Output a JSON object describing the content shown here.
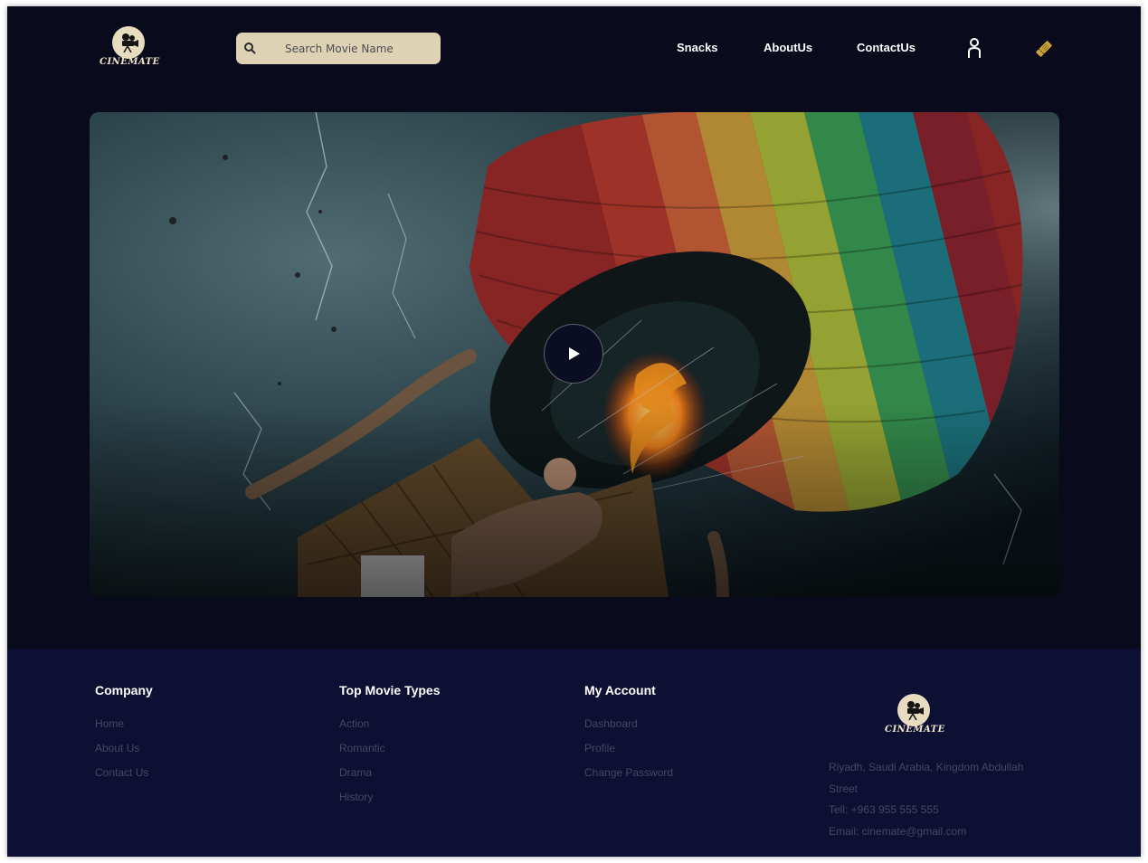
{
  "header": {
    "logo_text": "CINEMATE",
    "search_placeholder": "Search Movie Name",
    "nav": [
      "Snacks",
      "AboutUs",
      "ContactUs"
    ],
    "icons": {
      "search": "search-icon",
      "user": "user-icon",
      "ticket": "ticket-icon"
    }
  },
  "hero": {
    "play_icon": "play-icon"
  },
  "footer": {
    "columns": [
      {
        "title": "Company",
        "links": [
          "Home",
          "About Us",
          "Contact Us"
        ]
      },
      {
        "title": "Top Movie Types",
        "links": [
          "Action",
          "Romantic",
          "Drama",
          "History"
        ]
      },
      {
        "title": "My Account",
        "links": [
          "Dashboard",
          "Profile",
          "Change Password"
        ]
      }
    ],
    "logo_text": "CINEMATE",
    "address_line1": "Riyadh, Saudi Arabia, Kingdom Abdullah",
    "address_line2": "Street",
    "phone": "Tell: +963 955 555 555",
    "email": "Email: cinemate@gmail.com"
  },
  "colors": {
    "page_bg": "#090a1b",
    "footer_bg": "#0d0f33",
    "search_bg": "#ddd2b3",
    "accent_gold": "#c9a43a"
  }
}
